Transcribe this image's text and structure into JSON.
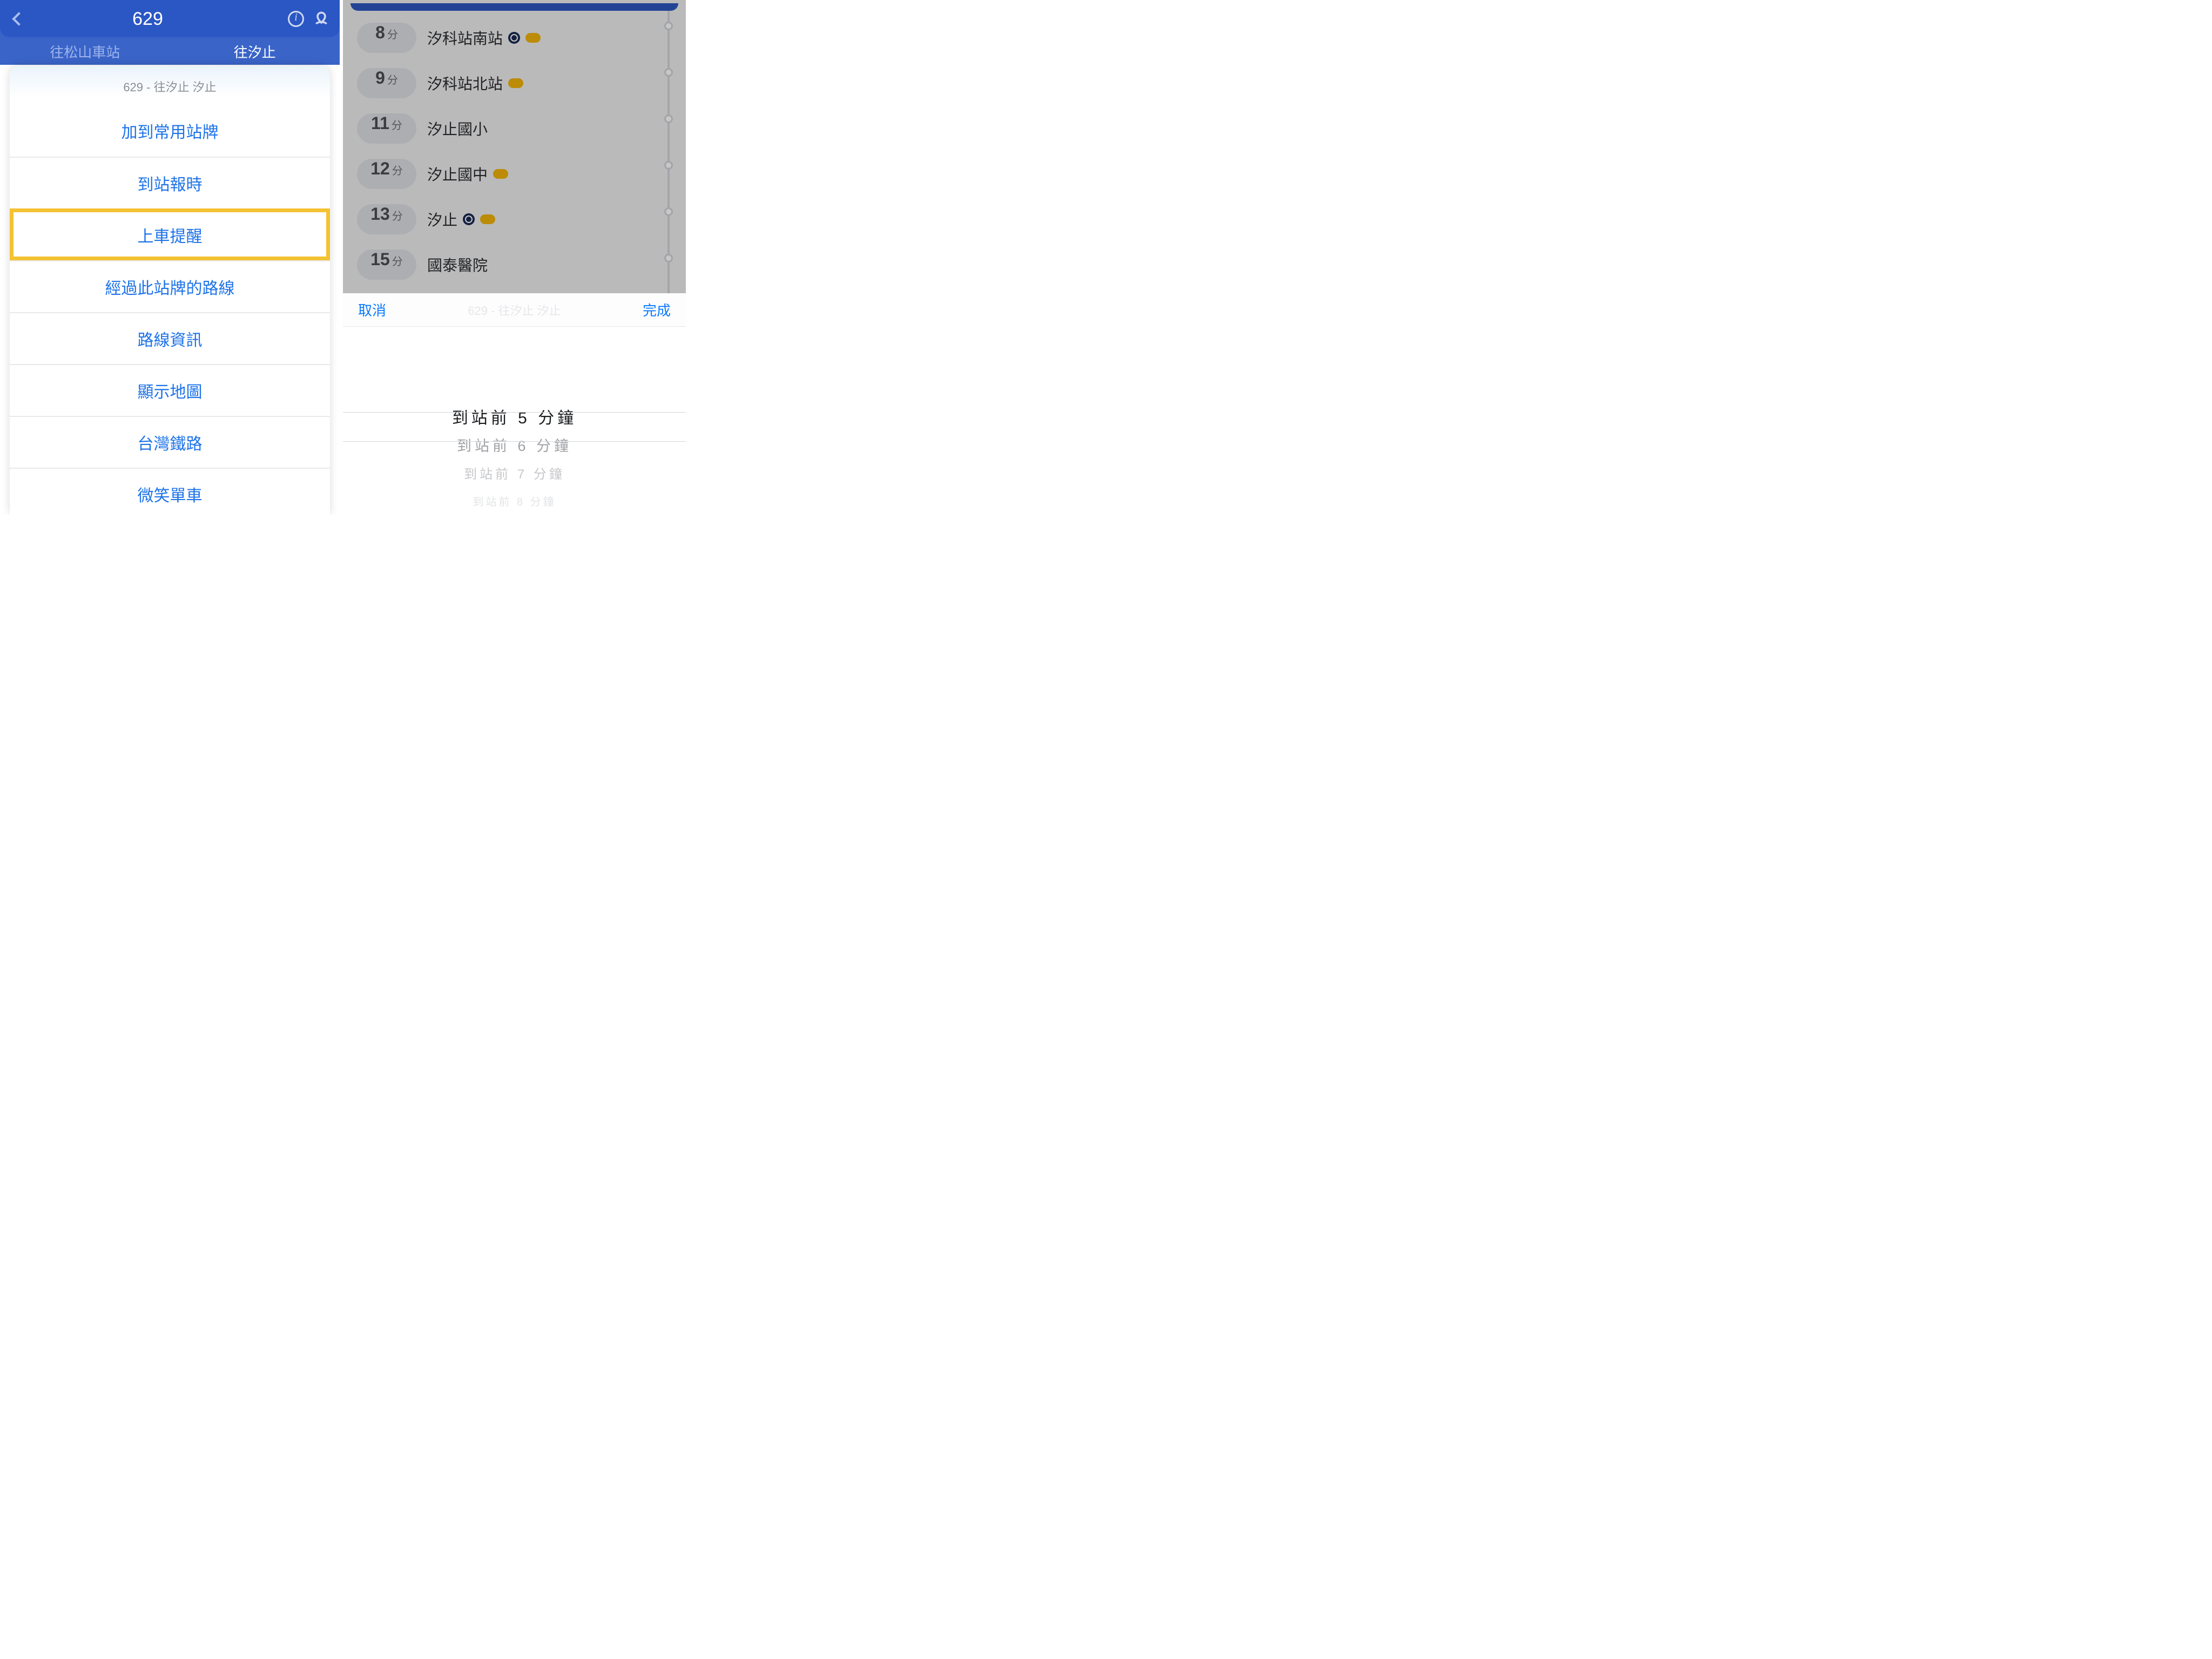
{
  "left": {
    "header": {
      "route_number": "629",
      "tabs": {
        "left": "往松山車站",
        "right": "往汐止"
      }
    },
    "sheet": {
      "title": "629 - 往汐止 汐止",
      "items": [
        "加到常用站牌",
        "到站報時",
        "上車提醒",
        "經過此站牌的路線",
        "路線資訊",
        "顯示地圖",
        "台灣鐵路",
        "微笑單車"
      ],
      "highlight_index": 2
    }
  },
  "right": {
    "stops": [
      {
        "minutes": "8",
        "unit": "分",
        "name": "汐科站南站",
        "rail": true,
        "bike": true
      },
      {
        "minutes": "9",
        "unit": "分",
        "name": "汐科站北站",
        "rail": false,
        "bike": true
      },
      {
        "minutes": "11",
        "unit": "分",
        "name": "汐止國小",
        "rail": false,
        "bike": false
      },
      {
        "minutes": "12",
        "unit": "分",
        "name": "汐止國中",
        "rail": false,
        "bike": true
      },
      {
        "minutes": "13",
        "unit": "分",
        "name": "汐止",
        "rail": true,
        "bike": true
      },
      {
        "minutes": "15",
        "unit": "分",
        "name": "國泰醫院",
        "rail": false,
        "bike": false
      }
    ],
    "picker": {
      "cancel": "取消",
      "done": "完成",
      "title": "629 - 往汐止 汐止",
      "options": [
        "到站前 5 分鐘",
        "到站前 6 分鐘",
        "到站前 7 分鐘",
        "到站前 8 分鐘"
      ]
    }
  }
}
